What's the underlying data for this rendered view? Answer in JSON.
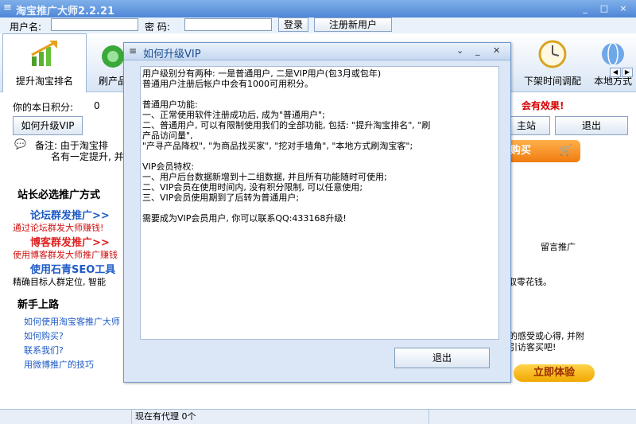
{
  "window": {
    "title": "淘宝推广大师2.2.21",
    "minimize": "_",
    "maximize": "□",
    "close": "×"
  },
  "login": {
    "username_label": "用户名:",
    "username_value": "",
    "password_label": "密  码:",
    "password_value": "",
    "login_button": "登录",
    "register_button": "注册新用户"
  },
  "toolbar": {
    "items": [
      {
        "label": "提升淘宝排名",
        "icon": "bar-chart-up-icon"
      },
      {
        "label": "刷产品",
        "icon": "product-icon"
      },
      {
        "label": "下架时间调配",
        "icon": "clock-icon"
      },
      {
        "label": "本地方式",
        "icon": "globe-icon"
      }
    ]
  },
  "main": {
    "score_label": "你的本日积分:",
    "score_value": "0",
    "effect_text": "会有效果!",
    "upgrade_button": "如何升级VIP",
    "station_button": "主站",
    "exit_button": "退出",
    "note_line1": "备注: 由于淘宝排",
    "note_line2": "名有一定提升, 并",
    "buy_button": "购买",
    "section_webmaster": "站长必选推广方式",
    "forum_link": "论坛群发推广>>",
    "forum_desc": "通过论坛群发大师赚钱!",
    "blog_link": "博客群发推广>>",
    "blog_desc": "使用博客群发大师推广赚钱",
    "seo_link": "使用石青SEO工具",
    "seo_desc": "精确目标人群定位, 智能",
    "message_promo": "留言推广",
    "earn_text": "赚取零花钱。",
    "section_newbie": "新手上路",
    "newbie_links": [
      "如何使用淘宝客推广大师",
      "如何购买?",
      "联系我们?",
      "用微博推广的技巧"
    ],
    "feedback_line1": "的感受或心得, 并附",
    "feedback_line2": "引访客买吧!",
    "try_button": "立即体验"
  },
  "status": {
    "agents_text": "现在有代理 0个"
  },
  "dialog": {
    "title": "如何升级VIP",
    "lines": [
      "用户级别分有两种: 一是普通用户, 二是VIP用户(包3月或包年)",
      "普通用户注册后帐户中会有1000可用积分。",
      "",
      "普通用户功能:",
      "一、正常使用软件注册成功后, 成为\"普通用户\";",
      "二、普通用户, 可以有限制使用我们的全部功能, 包括: \"提升淘宝排名\", \"刷",
      "产品访问量\",",
      "\"产寻产品降权\", \"为商品找买家\", \"挖对手墙角\", \"本地方式刷淘宝客\";",
      "",
      "VIP会员特权:",
      "一、用户后台数据新增到十二组数据, 并且所有功能随时可使用;",
      "二、VIP会员在使用时间内, 没有积分限制, 可以任意使用;",
      "三、VIP会员使用期到了后转为普通用户;",
      "",
      "需要成为VIP会员用户, 你可以联系QQ:433168升级!"
    ],
    "exit_button": "退出"
  }
}
